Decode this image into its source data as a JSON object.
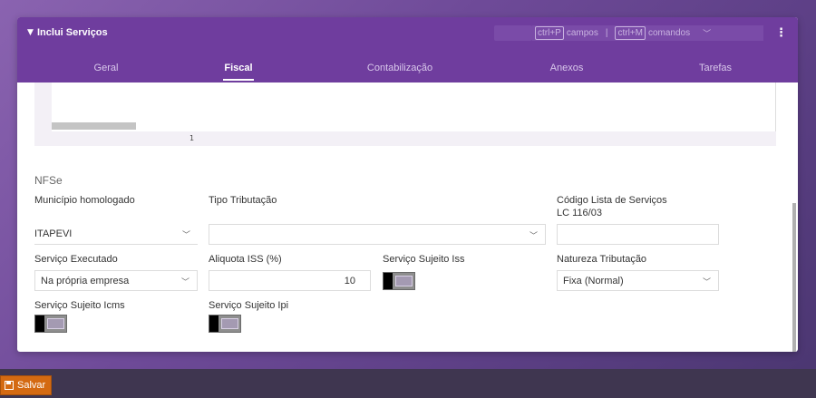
{
  "dialog": {
    "title": "Inclui Serviços",
    "shortcuts": {
      "key1": "ctrl+P",
      "label1": "campos",
      "separator": "|",
      "key2": "ctrl+M",
      "label2": "comandos"
    },
    "tabs": [
      {
        "label": "Geral",
        "active": false
      },
      {
        "label": "Fiscal",
        "active": true
      },
      {
        "label": "Contabilização",
        "active": false
      },
      {
        "label": "Anexos",
        "active": false
      },
      {
        "label": "Tarefas",
        "active": false
      }
    ]
  },
  "grid": {
    "page_number": "1"
  },
  "nfse": {
    "section_title": "NFSe",
    "municipio_label": "Município homologado",
    "municipio_value": "ITAPEVI",
    "tipo_tributacao_label": "Tipo Tributação",
    "tipo_tributacao_value": "",
    "codigo_lista_label_line1": "Código Lista de Serviços",
    "codigo_lista_label_line2": "LC 116/03",
    "codigo_lista_value": "",
    "servico_executado_label": "Serviço Executado",
    "servico_executado_value": "Na própria empresa",
    "aliquota_label": "Aliquota ISS (%)",
    "aliquota_value": "10",
    "sujeito_iss_label": "Serviço Sujeito Iss",
    "sujeito_iss_on": false,
    "natureza_label": "Natureza Tributação",
    "natureza_value": "Fixa (Normal)",
    "sujeito_icms_label": "Serviço Sujeito Icms",
    "sujeito_icms_on": false,
    "sujeito_ipi_label": "Serviço Sujeito Ipi",
    "sujeito_ipi_on": false
  },
  "footer": {
    "save_label": "Salvar"
  },
  "colors": {
    "header": "#6f3d9e",
    "save_button": "#d46a12"
  }
}
